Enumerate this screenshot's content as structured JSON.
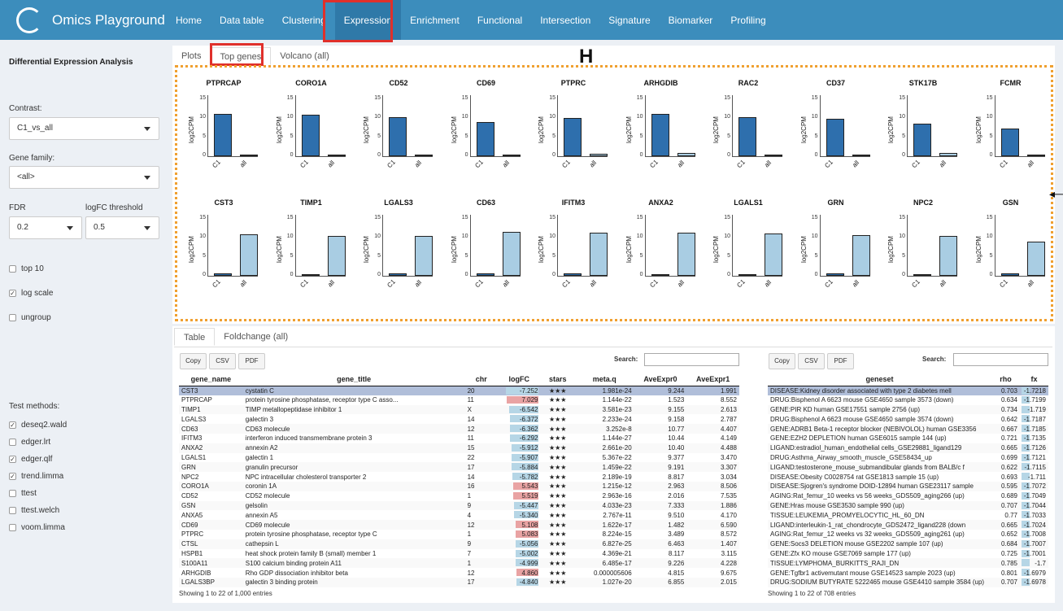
{
  "app": {
    "title": "Omics Playground"
  },
  "nav": [
    "Home",
    "Data table",
    "Clustering",
    "Expression",
    "Enrichment",
    "Functional",
    "Intersection",
    "Signature",
    "Biomarker",
    "Profiling"
  ],
  "nav_active": "Expression",
  "sidebar": {
    "title": "Differential Expression Analysis",
    "contrast_label": "Contrast:",
    "contrast_value": "C1_vs_all",
    "gene_family_label": "Gene family:",
    "gene_family_value": "<all>",
    "fdr_label": "FDR",
    "fdr_value": "0.2",
    "logfc_label": "logFC threshold",
    "logfc_value": "0.5",
    "options": [
      {
        "label": "top 10",
        "checked": false
      },
      {
        "label": "log scale",
        "checked": true
      },
      {
        "label": "ungroup",
        "checked": false
      }
    ],
    "test_methods_label": "Test methods:",
    "methods": [
      {
        "label": "deseq2.wald",
        "checked": true
      },
      {
        "label": "edger.lrt",
        "checked": false
      },
      {
        "label": "edger.qlf",
        "checked": true
      },
      {
        "label": "trend.limma",
        "checked": true
      },
      {
        "label": "ttest",
        "checked": false
      },
      {
        "label": "ttest.welch",
        "checked": false
      },
      {
        "label": "voom.limma",
        "checked": false
      }
    ]
  },
  "plot_tabs": [
    "Plots",
    "Top genes",
    "Volcano (all)"
  ],
  "plot_tab_active": "Top genes",
  "annotation_letter": "H",
  "plots": {
    "ylabel": "log2CPM",
    "yticks": [
      "0",
      "5",
      "10",
      "15"
    ],
    "xlabels": [
      "C1",
      "all"
    ],
    "colors": {
      "dark": "#2e6fad",
      "light": "#a9cde3"
    },
    "row1": [
      {
        "gene": "PTPRCAP",
        "c1": 11.0,
        "all": 0.4
      },
      {
        "gene": "CORO1A",
        "c1": 10.8,
        "all": 0.5
      },
      {
        "gene": "CD52",
        "c1": 10.3,
        "all": 0.4
      },
      {
        "gene": "CD69",
        "c1": 9.0,
        "all": 0.3
      },
      {
        "gene": "PTPRC",
        "c1": 10.0,
        "all": 0.6
      },
      {
        "gene": "ARHGDIB",
        "c1": 11.2,
        "all": 0.8
      },
      {
        "gene": "RAC2",
        "c1": 10.2,
        "all": 0.5
      },
      {
        "gene": "CD37",
        "c1": 9.8,
        "all": 0.3
      },
      {
        "gene": "STK17B",
        "c1": 8.6,
        "all": 0.8
      },
      {
        "gene": "FCMR",
        "c1": 7.2,
        "all": 0.3
      }
    ],
    "row2": [
      {
        "gene": "CST3",
        "c1": 0.6,
        "all": 10.9
      },
      {
        "gene": "TIMP1",
        "c1": 0.5,
        "all": 10.4
      },
      {
        "gene": "LGALS3",
        "c1": 0.6,
        "all": 10.5
      },
      {
        "gene": "CD63",
        "c1": 0.6,
        "all": 11.6
      },
      {
        "gene": "IFITM3",
        "c1": 0.6,
        "all": 11.4
      },
      {
        "gene": "ANXA2",
        "c1": 0.5,
        "all": 11.3
      },
      {
        "gene": "LGALS1",
        "c1": 0.5,
        "all": 11.2
      },
      {
        "gene": "GRN",
        "c1": 0.6,
        "all": 10.6
      },
      {
        "gene": "NPC2",
        "c1": 0.5,
        "all": 10.5
      },
      {
        "gene": "GSN",
        "c1": 0.6,
        "all": 9.0
      }
    ]
  },
  "table_tabs": [
    "Table",
    "Foldchange (all)"
  ],
  "table_tab_active": "Table",
  "buttons": [
    "Copy",
    "CSV",
    "PDF"
  ],
  "search_label": "Search:",
  "gene_table": {
    "columns": [
      "gene_name",
      "gene_title",
      "chr",
      "logFC",
      "stars",
      "meta.q",
      "AveExpr0",
      "AveExpr1"
    ],
    "rows": [
      [
        "CST3",
        "cystatin C",
        "20",
        "-7.252",
        "★★★",
        "1.981e-24",
        "9.244",
        "1.991"
      ],
      [
        "PTPRCAP",
        "protein tyrosine phosphatase, receptor type C asso...",
        "11",
        "7.029",
        "★★★",
        "1.144e-22",
        "1.523",
        "8.552"
      ],
      [
        "TIMP1",
        "TIMP metallopeptidase inhibitor 1",
        "X",
        "-6.542",
        "★★★",
        "3.581e-23",
        "9.155",
        "2.613"
      ],
      [
        "LGALS3",
        "galectin 3",
        "14",
        "-6.372",
        "★★★",
        "2.233e-24",
        "9.158",
        "2.787"
      ],
      [
        "CD63",
        "CD63 molecule",
        "12",
        "-6.362",
        "★★★",
        "3.252e-8",
        "10.77",
        "4.407"
      ],
      [
        "IFITM3",
        "interferon induced transmembrane protein 3",
        "11",
        "-6.292",
        "★★★",
        "1.144e-27",
        "10.44",
        "4.149"
      ],
      [
        "ANXA2",
        "annexin A2",
        "15",
        "-5.912",
        "★★★",
        "2.661e-20",
        "10.40",
        "4.488"
      ],
      [
        "LGALS1",
        "galectin 1",
        "22",
        "-5.907",
        "★★★",
        "5.367e-22",
        "9.377",
        "3.470"
      ],
      [
        "GRN",
        "granulin precursor",
        "17",
        "-5.884",
        "★★★",
        "1.459e-22",
        "9.191",
        "3.307"
      ],
      [
        "NPC2",
        "NPC intracellular cholesterol transporter 2",
        "14",
        "-5.782",
        "★★★",
        "2.189e-19",
        "8.817",
        "3.034"
      ],
      [
        "CORO1A",
        "coronin 1A",
        "16",
        "5.543",
        "★★★",
        "1.215e-12",
        "2.963",
        "8.506"
      ],
      [
        "CD52",
        "CD52 molecule",
        "1",
        "5.519",
        "★★★",
        "2.963e-16",
        "2.016",
        "7.535"
      ],
      [
        "GSN",
        "gelsolin",
        "9",
        "-5.447",
        "★★★",
        "4.033e-23",
        "7.333",
        "1.886"
      ],
      [
        "ANXA5",
        "annexin A5",
        "4",
        "-5.340",
        "★★★",
        "2.767e-11",
        "9.510",
        "4.170"
      ],
      [
        "CD69",
        "CD69 molecule",
        "12",
        "5.108",
        "★★★",
        "1.622e-17",
        "1.482",
        "6.590"
      ],
      [
        "PTPRC",
        "protein tyrosine phosphatase, receptor type C",
        "1",
        "5.083",
        "★★★",
        "8.224e-15",
        "3.489",
        "8.572"
      ],
      [
        "CTSL",
        "cathepsin L",
        "9",
        "-5.056",
        "★★★",
        "6.827e-25",
        "6.463",
        "1.407"
      ],
      [
        "HSPB1",
        "heat shock protein family B (small) member 1",
        "7",
        "-5.002",
        "★★★",
        "4.369e-21",
        "8.117",
        "3.115"
      ],
      [
        "S100A11",
        "S100 calcium binding protein A11",
        "1",
        "-4.999",
        "★★★",
        "6.485e-17",
        "9.226",
        "4.228"
      ],
      [
        "ARHGDIB",
        "Rho GDP dissociation inhibitor beta",
        "12",
        "4.860",
        "★★★",
        "0.000005606",
        "4.815",
        "9.675"
      ],
      [
        "LGALS3BP",
        "galectin 3 binding protein",
        "17",
        "-4.840",
        "★★★",
        "1.027e-20",
        "6.855",
        "2.015"
      ]
    ],
    "footer": "Showing 1 to 22 of 1,000 entries"
  },
  "geneset_table": {
    "columns": [
      "geneset",
      "rho",
      "fx"
    ],
    "rows": [
      [
        "DISEASE:Kidney disorder associated with type 2 diabetes mell",
        "0.703",
        "-1.7218"
      ],
      [
        "DRUG:Bisphenol A 6623 mouse GSE4650 sample 3573 (down)",
        "0.634",
        "-1.7199"
      ],
      [
        "GENE:PIR KD human GSE17551 sample 2756 (up)",
        "0.734",
        "-1.719"
      ],
      [
        "DRUG:Bisphenol A 6623 mouse GSE4650 sample 3574 (down)",
        "0.642",
        "-1.7187"
      ],
      [
        "GENE:ADRB1 Beta-1 receptor blocker (NEBIVOLOL) human GSE3356",
        "0.667",
        "-1.7185"
      ],
      [
        "GENE:EZH2 DEPLETION human GSE6015 sample 144 (up)",
        "0.721",
        "-1.7135"
      ],
      [
        "LIGAND:estradiol_human_endothelial cells_GSE29881_ligand129",
        "0.665",
        "-1.7126"
      ],
      [
        "DRUG:Asthma_Airway_smooth_muscle_GSE58434_up",
        "0.699",
        "-1.7121"
      ],
      [
        "LIGAND:testosterone_mouse_submandibular glands from BALB/c f",
        "0.622",
        "-1.7115"
      ],
      [
        "DISEASE:Obesity C0028754 rat GSE1813 sample 15 (up)",
        "0.693",
        "-1.711"
      ],
      [
        "DISEASE:Sjogren's syndrome DOID-12894 human GSE23117 sample",
        "0.595",
        "-1.7072"
      ],
      [
        "AGING:Rat_femur_10 weeks vs 56 weeks_GDS509_aging266 (up)",
        "0.689",
        "-1.7049"
      ],
      [
        "GENE:Hras mouse GSE3530 sample 990 (up)",
        "0.707",
        "-1.7044"
      ],
      [
        "TISSUE:LEUKEMIA_PROMYELOCYTIC_HL_60_DN",
        "0.77",
        "-1.7033"
      ],
      [
        "LIGAND:interleukin-1_rat_chondrocyte_GDS2472_ligand228 (down",
        "0.665",
        "-1.7024"
      ],
      [
        "AGING:Rat_femur_12 weeks vs 32 weeks_GDS509_aging261 (up)",
        "0.652",
        "-1.7008"
      ],
      [
        "GENE:Socs3 DELETION mouse GSE2202 sample 107 (up)",
        "0.684",
        "-1.7007"
      ],
      [
        "GENE:Zfx KO mouse GSE7069 sample 177 (up)",
        "0.725",
        "-1.7001"
      ],
      [
        "TISSUE:LYMPHOMA_BURKITTS_RAJI_DN",
        "0.785",
        "-1.7"
      ],
      [
        "GENE:Tgfbr1 activemutant mouse GSE14523 sample 2023 (up)",
        "0.801",
        "-1.6979"
      ],
      [
        "DRUG:SODIUM BUTYRATE 5222465 mouse GSE4410 sample 3584 (up)",
        "0.707",
        "-1.6978"
      ]
    ],
    "footer": "Showing 1 to 22 of 708 entries"
  }
}
